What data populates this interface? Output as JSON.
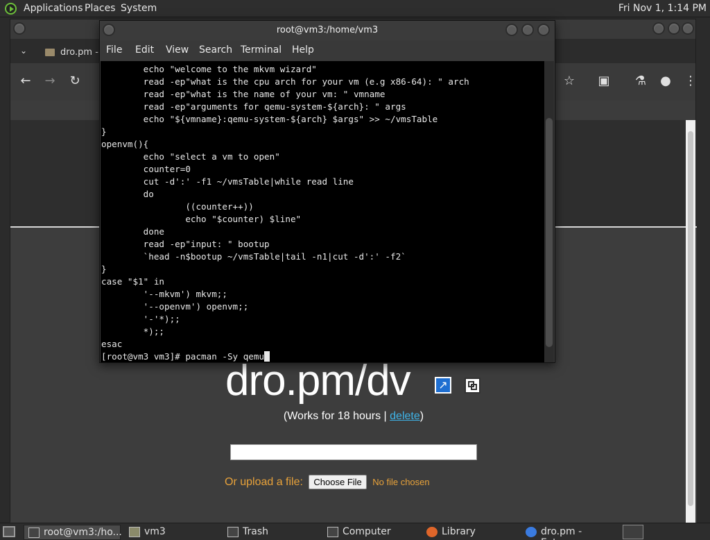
{
  "top_panel": {
    "menus": [
      "Applications",
      "Places",
      "System"
    ],
    "clock": "Fri Nov 1, 1:14 PM"
  },
  "browser": {
    "tab_title": "dro.pm - I",
    "page": {
      "short_link": "dro.pm/dv",
      "works_prefix": "(Works for 18 hours | ",
      "delete_link": "delete",
      "works_suffix": ")",
      "upload_label": "Or upload a file:",
      "choose_file": "Choose File",
      "no_file": "No file chosen"
    }
  },
  "terminal": {
    "title": "root@vm3:/home/vm3",
    "menu": [
      "File",
      "Edit",
      "View",
      "Search",
      "Terminal",
      "Help"
    ],
    "lines": [
      "        echo \"welcome to the mkvm wizard\"",
      "        read -ep\"what is the cpu arch for your vm (e.g x86-64): \" arch",
      "        read -ep\"what is the name of your vm: \" vmname",
      "        read -ep\"arguments for qemu-system-${arch}: \" args",
      "        echo \"${vmname}:qemu-system-${arch} $args\" >> ~/vmsTable",
      "}",
      "openvm(){",
      "        echo \"select a vm to open\"",
      "        counter=0",
      "        cut -d':' -f1 ~/vmsTable|while read line",
      "        do",
      "                ((counter++))",
      "                echo \"$counter) $line\"",
      "        done",
      "        read -ep\"input: \" bootup",
      "        `head -n$bootup ~/vmsTable|tail -n1|cut -d':' -f2`",
      "}",
      "case \"$1\" in",
      "        '--mkvm') mkvm;;",
      "        '--openvm') openvm;;",
      "        '-'*);;",
      "        *);;",
      "esac"
    ],
    "prompt": "[root@vm3 vm3]# pacman -Sy qemu"
  },
  "taskbar": {
    "items": [
      "root@vm3:/ho...",
      "vm3",
      "Trash",
      "Computer",
      "Library",
      "dro.pm - Extre..."
    ]
  }
}
